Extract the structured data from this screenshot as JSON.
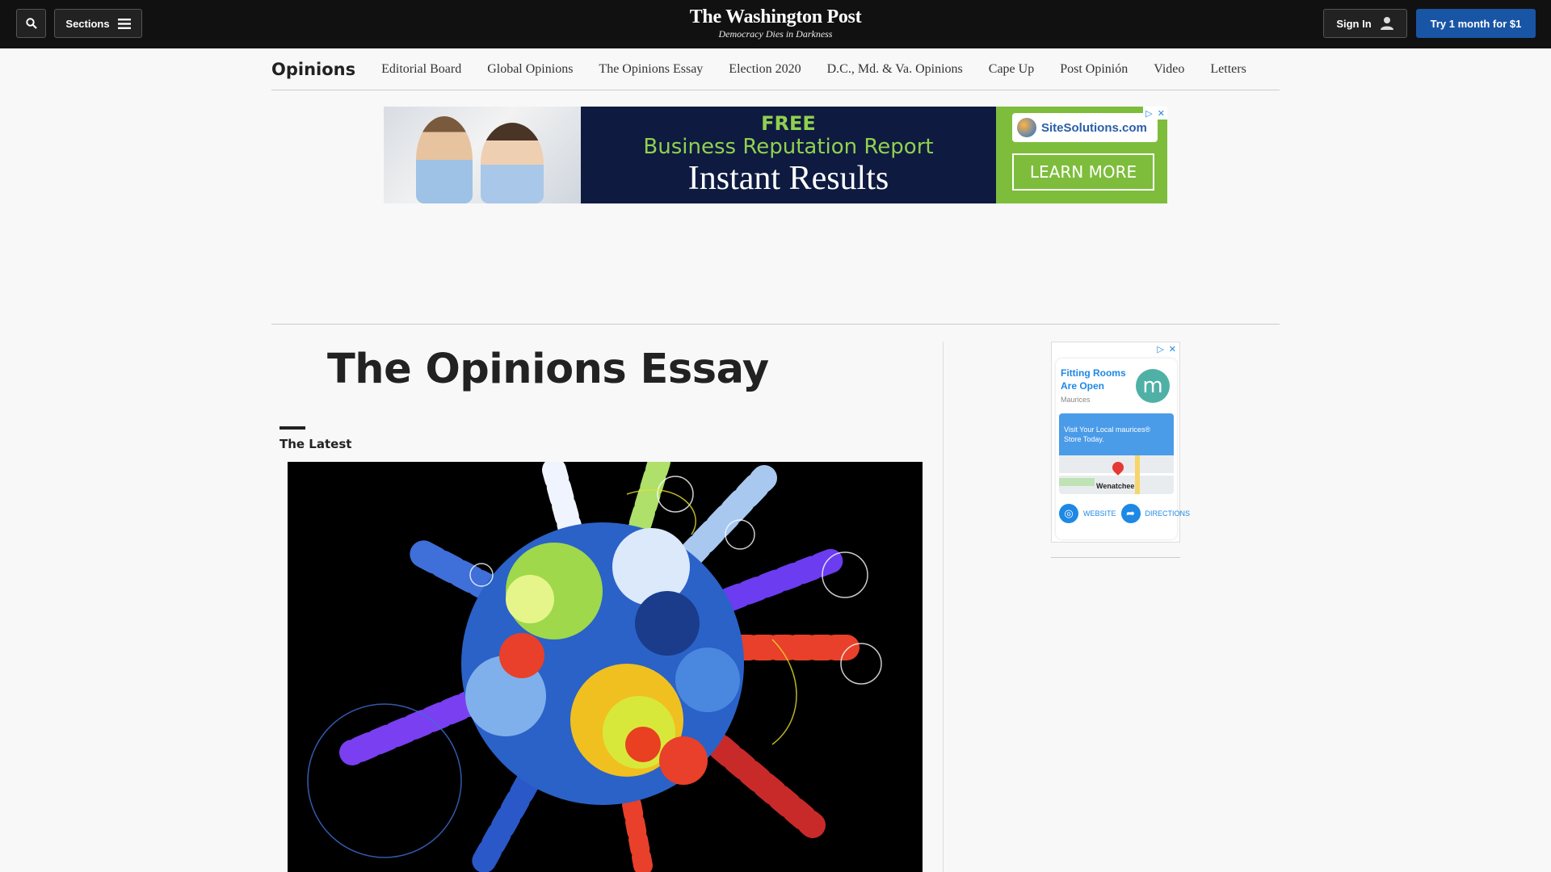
{
  "header": {
    "sections_label": "Sections",
    "logo_name": "The Washington Post",
    "logo_tagline": "Democracy Dies in Darkness",
    "signin_label": "Sign In",
    "subscribe_label": "Try 1 month for $1",
    "accent_color": "#1955a5"
  },
  "subnav": {
    "title": "Opinions",
    "items": [
      "Editorial Board",
      "Global Opinions",
      "The Opinions Essay",
      "Election 2020",
      "D.C., Md. & Va. Opinions",
      "Cape Up",
      "Post Opinión",
      "Video",
      "Letters"
    ]
  },
  "banner_ad": {
    "headline_1": "FREE",
    "headline_2": "Business Reputation Report",
    "headline_3": "Instant Results",
    "brand": "SiteSolutions.com",
    "cta": "LEARN MORE"
  },
  "main": {
    "page_title": "The Opinions Essay",
    "section_label": "The Latest"
  },
  "side_ad": {
    "title": "Fitting Rooms Are Open",
    "brand": "Maurices",
    "logo_letter": "m",
    "body": "Visit Your Local maurices® Store Today.",
    "city": "Wenatchee",
    "website_label": "WEBSITE",
    "directions_label": "DIRECTIONS"
  }
}
